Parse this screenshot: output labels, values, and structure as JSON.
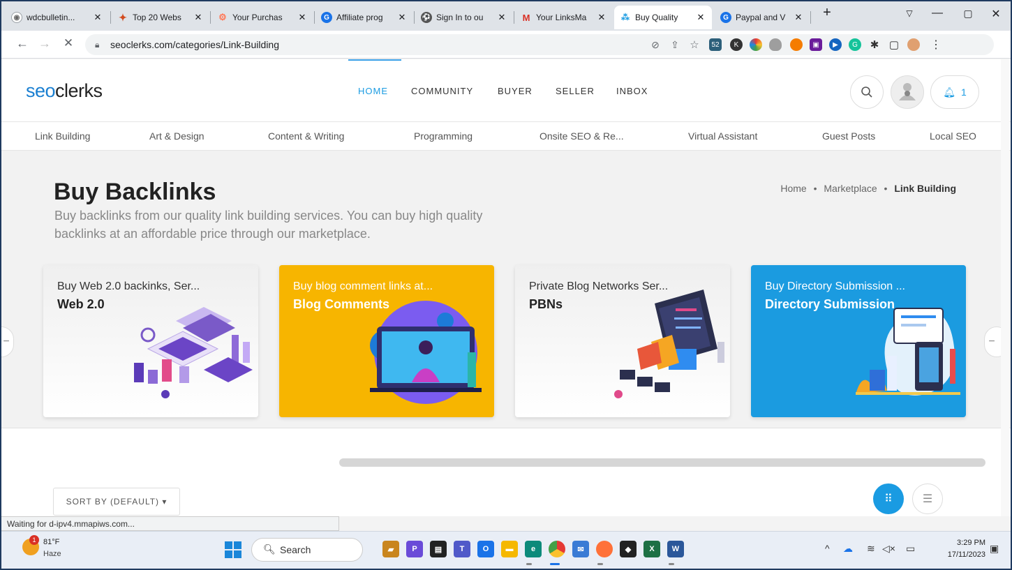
{
  "browser": {
    "tabs": [
      {
        "title": "wdcbulletin...",
        "icon": "globe-icon",
        "color": "#9aa0a6"
      },
      {
        "title": "Top 20 Webs",
        "icon": "maple-leaf-icon",
        "color": "#d24b1f"
      },
      {
        "title": "Your Purchas",
        "icon": "hubspot-icon",
        "color": "#ff7a59"
      },
      {
        "title": "Affiliate prog",
        "icon": "chrome-g-icon",
        "color": "#1a73e8"
      },
      {
        "title": "Sign In to ou",
        "icon": "soccer-ball-icon",
        "color": "#555555"
      },
      {
        "title": "Your LinksMa",
        "icon": "gmail-icon",
        "color": "#d93025"
      },
      {
        "title": "Buy Quality",
        "icon": "seoclerks-icon",
        "color": "#1a9be2",
        "active": true
      },
      {
        "title": "Paypal and V",
        "icon": "chrome-g-icon",
        "color": "#1a73e8"
      }
    ],
    "new_tab": "+",
    "url": "seoclerks.com/categories/Link-Building",
    "status_text": "Waiting for d-ipv4.mmapiws.com..."
  },
  "site": {
    "logo_seo": "seo",
    "logo_rest": "clerks",
    "nav": [
      "HOME",
      "COMMUNITY",
      "BUYER",
      "SELLER",
      "INBOX"
    ],
    "notif_count": "1",
    "categories": [
      "Link Building",
      "Art & Design",
      "Content & Writing",
      "Programming",
      "Onsite SEO & Re...",
      "Virtual Assistant",
      "Guest Posts",
      "Local SEO"
    ],
    "heading": "Buy Backlinks",
    "subheading": "Buy backlinks from our quality link building services. You can buy high quality backlinks at an affordable price through our marketplace.",
    "breadcrumb": {
      "home": "Home",
      "sep": "•",
      "market": "Marketplace",
      "current": "Link Building"
    },
    "cards": [
      {
        "pre": "Buy Web 2.0 backinks, Ser...",
        "name": "Web 2.0"
      },
      {
        "pre": "Buy blog comment links at...",
        "name": "Blog Comments"
      },
      {
        "pre": "Private Blog Networks Ser...",
        "name": "PBNs"
      },
      {
        "pre": "Buy Directory Submission ...",
        "name": "Directory Submission"
      }
    ],
    "sort_label": "SORT BY (DEFAULT) ▾"
  },
  "taskbar": {
    "temp": "81°F",
    "condition": "Haze",
    "weather_badge": "1",
    "search": "Search",
    "time": "3:29 PM",
    "date": "17/11/2023"
  }
}
